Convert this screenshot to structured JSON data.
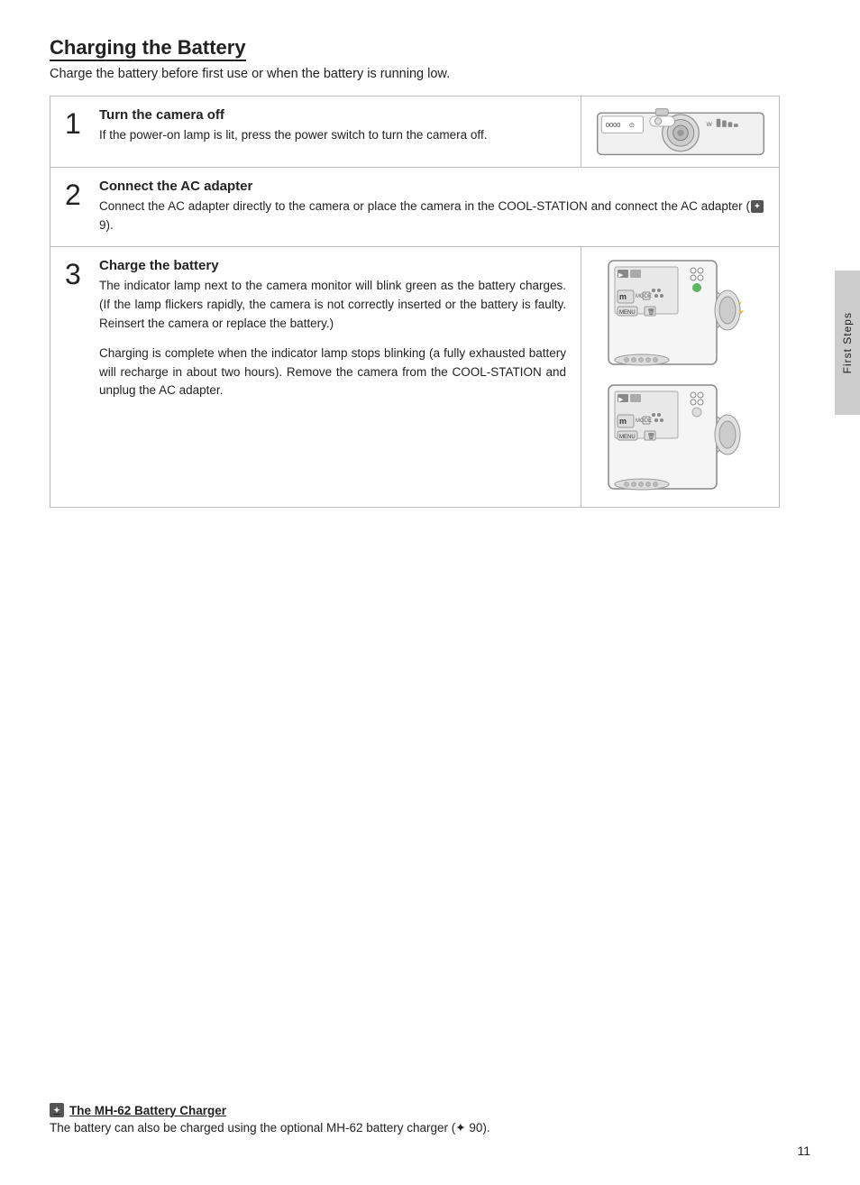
{
  "page": {
    "title": "Charging the Battery",
    "subtitle": "Charge the battery before first use or when the battery is running low.",
    "sidebar_label": "First Steps",
    "page_number": "11"
  },
  "steps": [
    {
      "number": "1",
      "heading": "Turn the camera off",
      "body": "If the power-on lamp is lit, press the power switch to turn the camera off.",
      "has_image": true,
      "image_type": "camera_top"
    },
    {
      "number": "2",
      "heading": "Connect the AC adapter",
      "body": "Connect the AC adapter directly to the camera or place the camera in the COOL-STATION and connect the AC adapter (",
      "body_ref": "9",
      "body_suffix": ").",
      "has_image": false
    },
    {
      "number": "3",
      "heading": "Charge the battery",
      "body1": "The indicator lamp next to the camera monitor will blink green as the battery charges.  (If the lamp flickers rapidly, the camera is not correctly inserted or the battery is faulty.  Reinsert the camera or replace the battery.)",
      "body2": "Charging is complete when the indicator lamp stops blinking (a fully exhausted battery will recharge in about two hours).  Remove the camera from the COOL-STATION and unplug the AC adapter.",
      "has_image": true,
      "image_type": "camera_side_double"
    }
  ],
  "footer": {
    "title": "The MH-62 Battery Charger",
    "body": "The battery can also be charged using the optional MH-62 battery charger (",
    "ref": "90",
    "body_suffix": ")."
  }
}
